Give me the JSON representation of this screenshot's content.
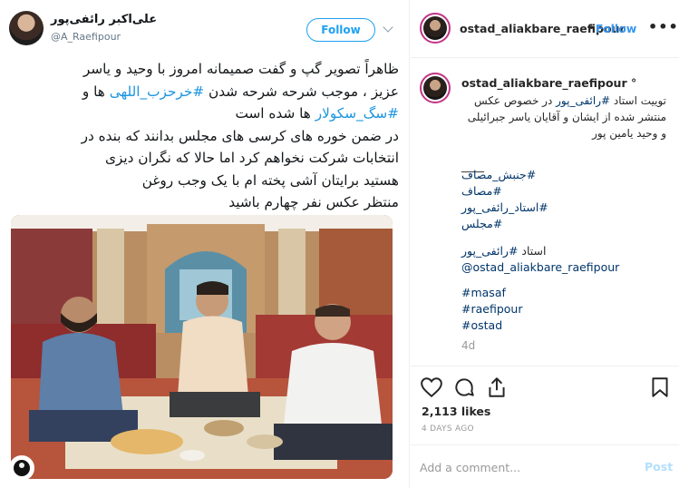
{
  "tweet": {
    "name": "علی‌اکبر رائفی‌پور",
    "handle": "@A_Raefipour",
    "follow_label": "Follow",
    "lines": [
      {
        "text": "ظاهراً تصویر گپ و گفت صمیمانه امروز با وحید و یاسر",
        "tag": ""
      },
      {
        "text": "عزیز ، موجب شرحه شرحه شدن ",
        "tag": "#خرحزب_اللهی",
        "after": " ها و"
      },
      {
        "text": "",
        "tag": "#سگ_سکولار",
        "after": " ها شده است"
      },
      {
        "text": "در ضمن خوره های کرسی های مجلس بدانند که بنده در",
        "tag": ""
      },
      {
        "text": "انتخابات شرکت نخواهم کرد اما حالا که نگران دیزی",
        "tag": ""
      },
      {
        "text": "هستید برایتان آشی پخته ام با یک وجب روغن",
        "tag": ""
      },
      {
        "text": "منتظر عکس نفر چهارم باشید",
        "tag": ""
      }
    ]
  },
  "instagram": {
    "header": {
      "username": "ostad_aliakbare_raefipour",
      "dot": "•",
      "follow_label": "Follow",
      "more": "•••"
    },
    "caption": {
      "username": "ostad_aliakbare_raefipour",
      "verified_mark": "°",
      "intro": "توییت استاد ",
      "intro_tag": "#رائفی_پور",
      "intro_rest": " در خصوص عکس منتشر شده از ایشان و آقایان یاسر جبرائیلی و وحید یامین پور",
      "separator": "____",
      "tags_fa": [
        "#جنبش_مصاف",
        "#مصاف",
        "#استاد_رائفی_پور",
        "#مجلس"
      ],
      "ostad_label": "استاد ",
      "ostad_tag": "#رائفی_پور",
      "mention": "@ostad_aliakbare_raefipour",
      "tags_en": [
        "#masaf",
        "#raefipour",
        "#ostad"
      ],
      "time": "4d"
    },
    "likes": "2,113 likes",
    "date": "4 DAYS AGO",
    "comment_placeholder": "Add a comment...",
    "post_label": "Post"
  }
}
